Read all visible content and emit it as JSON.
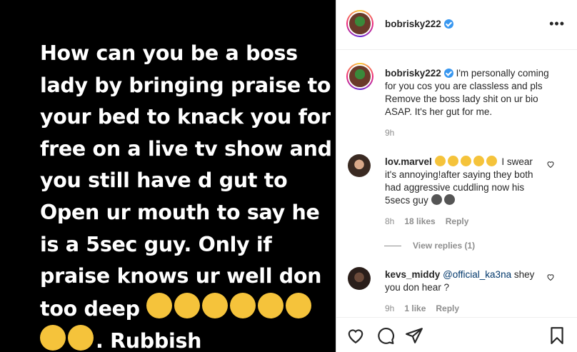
{
  "post": {
    "caption_text": "How can you be a boss lady by bringing praise to your bed to knack you for free on a live tv show and you still have d gut to Open ur mouth to say he is a 5sec guy. Only if praise knows ur well don too deep",
    "caption_end": ". Rubbish",
    "caption_emoji_icon": "laughing-crying-emoji"
  },
  "header": {
    "username": "bobrisky222",
    "more_label": "•••"
  },
  "main_comment": {
    "username": "bobrisky222",
    "text": "I'm personally coming for you cos you are classless and pls Remove the boss lady shit on ur bio ASAP. It's her gut for me.",
    "time": "9h"
  },
  "comments": [
    {
      "username": "lov.marvel",
      "text": "I swear it's annoying!after saying they both had aggressive cuddling now his 5secs guy",
      "time": "8h",
      "likes": "18 likes",
      "reply": "Reply",
      "view_replies": "View replies (1)"
    },
    {
      "username": "kevs_middy",
      "mention": "@official_ka3na",
      "text": "shey you don hear ?",
      "time": "9h",
      "likes": "1 like",
      "reply": "Reply"
    }
  ],
  "colors": {
    "accent": "#3897f0",
    "text": "#262626",
    "muted": "#8e8e8e",
    "media_bg": "#000000"
  }
}
